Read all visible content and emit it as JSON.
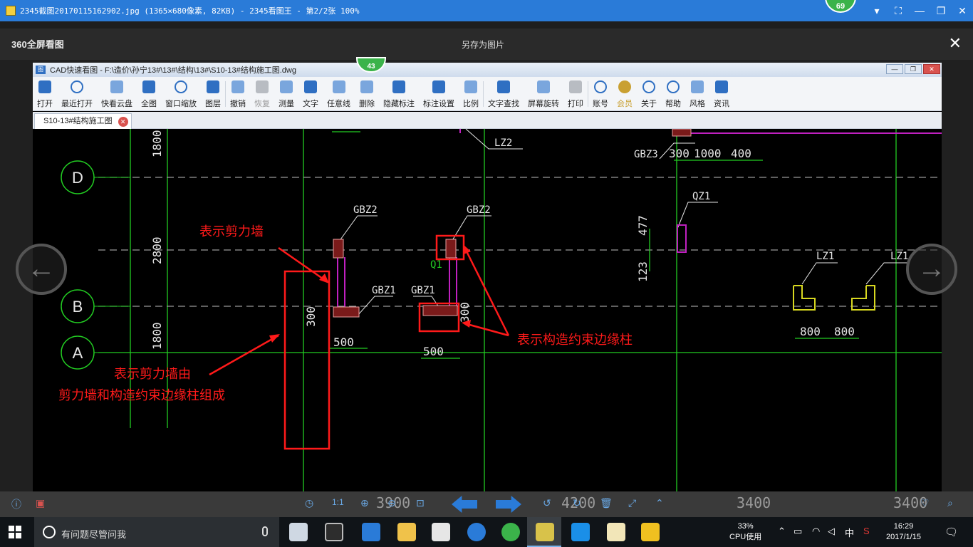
{
  "viewer_window": {
    "title": "2345截图20170115162902.jpg (1365×680像素, 82KB) - 2345看图王 - 第2/2张 100%",
    "badge": "69",
    "controls": {
      "chevron": "▾",
      "fullscreen": "⛶",
      "minimize": "—",
      "restore": "❐",
      "close": "✕"
    }
  },
  "viewer_strip": {
    "brand": "360全屏看图",
    "save_label": "另存为图片",
    "close": "✕"
  },
  "cad_window": {
    "title": "CAD快速看图 - F:\\造价\\孙宁13#\\13#\\结构\\13#\\S10-13#结构施工图.dwg",
    "badge": "43",
    "toolbar": [
      {
        "label": "打开",
        "icon": "folder-icon"
      },
      {
        "label": "最近打开",
        "icon": "history-icon"
      },
      {
        "label": "快看云盘",
        "icon": "cloud-icon"
      },
      {
        "label": "全图",
        "icon": "fit-all-icon"
      },
      {
        "label": "窗口缩放",
        "icon": "window-zoom-icon"
      },
      {
        "label": "图层",
        "icon": "layers-icon"
      },
      {
        "label": "撤销",
        "icon": "undo-icon"
      },
      {
        "label": "恢复",
        "icon": "redo-icon"
      },
      {
        "label": "测量",
        "icon": "measure-icon"
      },
      {
        "label": "文字",
        "icon": "text-icon"
      },
      {
        "label": "任意线",
        "icon": "pencil-icon"
      },
      {
        "label": "删除",
        "icon": "eraser-icon"
      },
      {
        "label": "隐藏标注",
        "icon": "hide-eye-icon"
      },
      {
        "label": "标注设置",
        "icon": "dimension-settings-icon"
      },
      {
        "label": "比例",
        "icon": "scale-icon"
      },
      {
        "label": "文字查找",
        "icon": "text-search-icon"
      },
      {
        "label": "屏幕旋转",
        "icon": "rotate-screen-icon"
      },
      {
        "label": "打印",
        "icon": "printer-icon"
      },
      {
        "label": "账号",
        "icon": "user-icon"
      },
      {
        "label": "会员",
        "icon": "vip-icon"
      },
      {
        "label": "关于",
        "icon": "info-icon"
      },
      {
        "label": "帮助",
        "icon": "help-icon"
      },
      {
        "label": "风格",
        "icon": "style-icon"
      },
      {
        "label": "资讯",
        "icon": "news-icon"
      }
    ],
    "tab_label": "S10-13#结构施工图"
  },
  "drawing": {
    "axis_labels": [
      "D",
      "B",
      "A"
    ],
    "dims_vertical": [
      "1800",
      "2800",
      "1800",
      "477",
      "123",
      "300",
      "300"
    ],
    "dims_horizontal": [
      "300",
      "1000",
      "400",
      "500",
      "500",
      "800",
      "800",
      "3900",
      "4200",
      "3400",
      "3400"
    ],
    "component_labels": [
      "LZ2",
      "GBZ3",
      "QZ1",
      "GBZ2",
      "GBZ2",
      "GBZ1",
      "GBZ1",
      "LZ1",
      "LZ1",
      "Q1"
    ],
    "annotations": {
      "shear_wall": "表示剪力墙",
      "boundary_column": "表示构造约束边缘柱",
      "composition_line1": "表示剪力墙由",
      "composition_line2": "剪力墙和构造约束边缘柱组成"
    }
  },
  "viewer_bottom": {
    "zoom_ratio": "1:1"
  },
  "taskbar": {
    "search_placeholder": "有问题尽管问我",
    "cpu_percent": "33%",
    "cpu_label": "CPU使用",
    "ime": "中",
    "time": "16:29",
    "date": "2017/1/15"
  },
  "colors": {
    "titlebar": "#2a7bd8",
    "cad_bg": "#000000",
    "grid_green": "#22cc22",
    "annotation_red": "#ff1a1a",
    "column_magenta": "#c020c0",
    "label_white": "#e6e6e6",
    "lz_yellow": "#d8d820"
  }
}
